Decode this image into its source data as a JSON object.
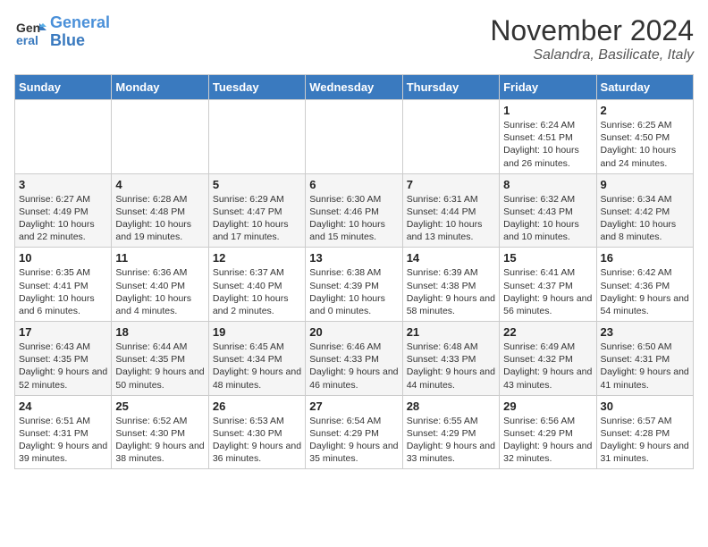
{
  "logo": {
    "line1": "General",
    "line2": "Blue"
  },
  "title": "November 2024",
  "location": "Salandra, Basilicate, Italy",
  "days_of_week": [
    "Sunday",
    "Monday",
    "Tuesday",
    "Wednesday",
    "Thursday",
    "Friday",
    "Saturday"
  ],
  "weeks": [
    [
      {
        "day": "",
        "info": ""
      },
      {
        "day": "",
        "info": ""
      },
      {
        "day": "",
        "info": ""
      },
      {
        "day": "",
        "info": ""
      },
      {
        "day": "",
        "info": ""
      },
      {
        "day": "1",
        "info": "Sunrise: 6:24 AM\nSunset: 4:51 PM\nDaylight: 10 hours and 26 minutes."
      },
      {
        "day": "2",
        "info": "Sunrise: 6:25 AM\nSunset: 4:50 PM\nDaylight: 10 hours and 24 minutes."
      }
    ],
    [
      {
        "day": "3",
        "info": "Sunrise: 6:27 AM\nSunset: 4:49 PM\nDaylight: 10 hours and 22 minutes."
      },
      {
        "day": "4",
        "info": "Sunrise: 6:28 AM\nSunset: 4:48 PM\nDaylight: 10 hours and 19 minutes."
      },
      {
        "day": "5",
        "info": "Sunrise: 6:29 AM\nSunset: 4:47 PM\nDaylight: 10 hours and 17 minutes."
      },
      {
        "day": "6",
        "info": "Sunrise: 6:30 AM\nSunset: 4:46 PM\nDaylight: 10 hours and 15 minutes."
      },
      {
        "day": "7",
        "info": "Sunrise: 6:31 AM\nSunset: 4:44 PM\nDaylight: 10 hours and 13 minutes."
      },
      {
        "day": "8",
        "info": "Sunrise: 6:32 AM\nSunset: 4:43 PM\nDaylight: 10 hours and 10 minutes."
      },
      {
        "day": "9",
        "info": "Sunrise: 6:34 AM\nSunset: 4:42 PM\nDaylight: 10 hours and 8 minutes."
      }
    ],
    [
      {
        "day": "10",
        "info": "Sunrise: 6:35 AM\nSunset: 4:41 PM\nDaylight: 10 hours and 6 minutes."
      },
      {
        "day": "11",
        "info": "Sunrise: 6:36 AM\nSunset: 4:40 PM\nDaylight: 10 hours and 4 minutes."
      },
      {
        "day": "12",
        "info": "Sunrise: 6:37 AM\nSunset: 4:40 PM\nDaylight: 10 hours and 2 minutes."
      },
      {
        "day": "13",
        "info": "Sunrise: 6:38 AM\nSunset: 4:39 PM\nDaylight: 10 hours and 0 minutes."
      },
      {
        "day": "14",
        "info": "Sunrise: 6:39 AM\nSunset: 4:38 PM\nDaylight: 9 hours and 58 minutes."
      },
      {
        "day": "15",
        "info": "Sunrise: 6:41 AM\nSunset: 4:37 PM\nDaylight: 9 hours and 56 minutes."
      },
      {
        "day": "16",
        "info": "Sunrise: 6:42 AM\nSunset: 4:36 PM\nDaylight: 9 hours and 54 minutes."
      }
    ],
    [
      {
        "day": "17",
        "info": "Sunrise: 6:43 AM\nSunset: 4:35 PM\nDaylight: 9 hours and 52 minutes."
      },
      {
        "day": "18",
        "info": "Sunrise: 6:44 AM\nSunset: 4:35 PM\nDaylight: 9 hours and 50 minutes."
      },
      {
        "day": "19",
        "info": "Sunrise: 6:45 AM\nSunset: 4:34 PM\nDaylight: 9 hours and 48 minutes."
      },
      {
        "day": "20",
        "info": "Sunrise: 6:46 AM\nSunset: 4:33 PM\nDaylight: 9 hours and 46 minutes."
      },
      {
        "day": "21",
        "info": "Sunrise: 6:48 AM\nSunset: 4:33 PM\nDaylight: 9 hours and 44 minutes."
      },
      {
        "day": "22",
        "info": "Sunrise: 6:49 AM\nSunset: 4:32 PM\nDaylight: 9 hours and 43 minutes."
      },
      {
        "day": "23",
        "info": "Sunrise: 6:50 AM\nSunset: 4:31 PM\nDaylight: 9 hours and 41 minutes."
      }
    ],
    [
      {
        "day": "24",
        "info": "Sunrise: 6:51 AM\nSunset: 4:31 PM\nDaylight: 9 hours and 39 minutes."
      },
      {
        "day": "25",
        "info": "Sunrise: 6:52 AM\nSunset: 4:30 PM\nDaylight: 9 hours and 38 minutes."
      },
      {
        "day": "26",
        "info": "Sunrise: 6:53 AM\nSunset: 4:30 PM\nDaylight: 9 hours and 36 minutes."
      },
      {
        "day": "27",
        "info": "Sunrise: 6:54 AM\nSunset: 4:29 PM\nDaylight: 9 hours and 35 minutes."
      },
      {
        "day": "28",
        "info": "Sunrise: 6:55 AM\nSunset: 4:29 PM\nDaylight: 9 hours and 33 minutes."
      },
      {
        "day": "29",
        "info": "Sunrise: 6:56 AM\nSunset: 4:29 PM\nDaylight: 9 hours and 32 minutes."
      },
      {
        "day": "30",
        "info": "Sunrise: 6:57 AM\nSunset: 4:28 PM\nDaylight: 9 hours and 31 minutes."
      }
    ]
  ]
}
